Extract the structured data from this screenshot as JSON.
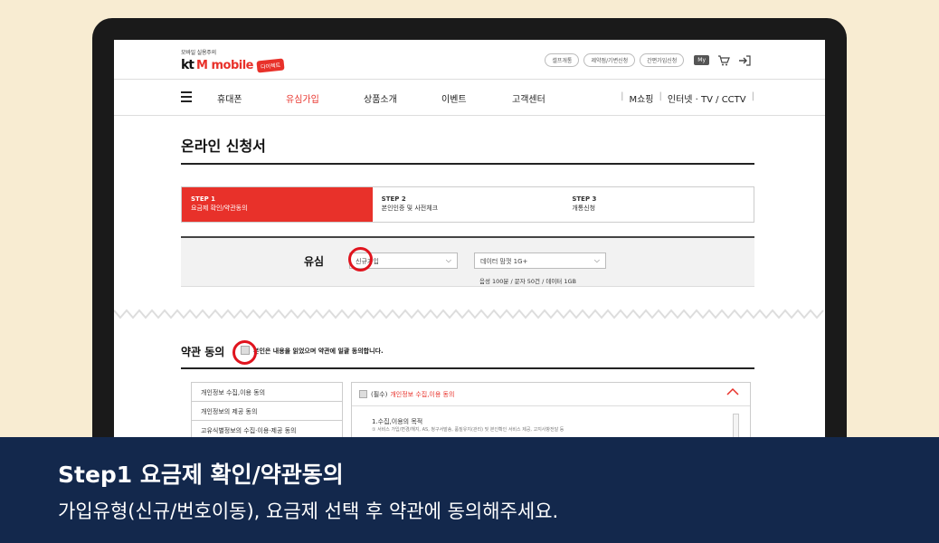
{
  "header": {
    "slogan": "모바일 실용주의",
    "logo_kt": "kt",
    "logo_brand": "M mobile",
    "logo_badge": "다이렉트",
    "util_links": [
      "셀프개통",
      "제약점/기변신청",
      "간편가입신청"
    ],
    "my_label": "My"
  },
  "nav": {
    "items": [
      "휴대폰",
      "유심가입",
      "상품소개",
      "이벤트",
      "고객센터"
    ],
    "active_index": 1,
    "right": [
      "M쇼핑",
      "인터넷 · TV / CCTV"
    ]
  },
  "page_title": "온라인 신청서",
  "steps": [
    {
      "num": "STEP 1",
      "label": "요금제 확인/약관동의",
      "active": true
    },
    {
      "num": "STEP 2",
      "label": "본인인증 및 사전체크",
      "active": false
    },
    {
      "num": "STEP 3",
      "label": "개통신청",
      "active": false
    }
  ],
  "usim": {
    "label": "유심",
    "join_type_value": "신규가입",
    "plan_value": "데이터 맘껏 1G+",
    "plan_info": "음성 100분 / 문자 50건 / 데이터 1GB"
  },
  "agreement": {
    "title": "약관 동의",
    "all_text": "본인은 내용을 읽었으며 약관에 일괄 동의합니다.",
    "terms": [
      "개인정보 수집,이용 동의",
      "개인정보의 제공 동의",
      "고유식별정보의 수집·이용·제공 동의"
    ],
    "detail_required": "(필수)",
    "detail_title": "개인정보 수집,이용 동의",
    "detail_heading": "1.수집,이용의 목적",
    "detail_text": "① 서비스 가입/변경/해지, AS, 청구서발송, 품질유지(관리) 및 본인확인 서비스 제공, 고지사항전달 등"
  },
  "caption": {
    "title": "Step1 요금제 확인/약관동의",
    "subtitle": "가입유형(신규/번호이동), 요금제 선택 후 약관에 동의해주세요."
  },
  "colors": {
    "accent": "#e8312a",
    "highlight_circle": "#e0141e",
    "caption_bg": "#13284c",
    "background": "#f8ecd2"
  }
}
